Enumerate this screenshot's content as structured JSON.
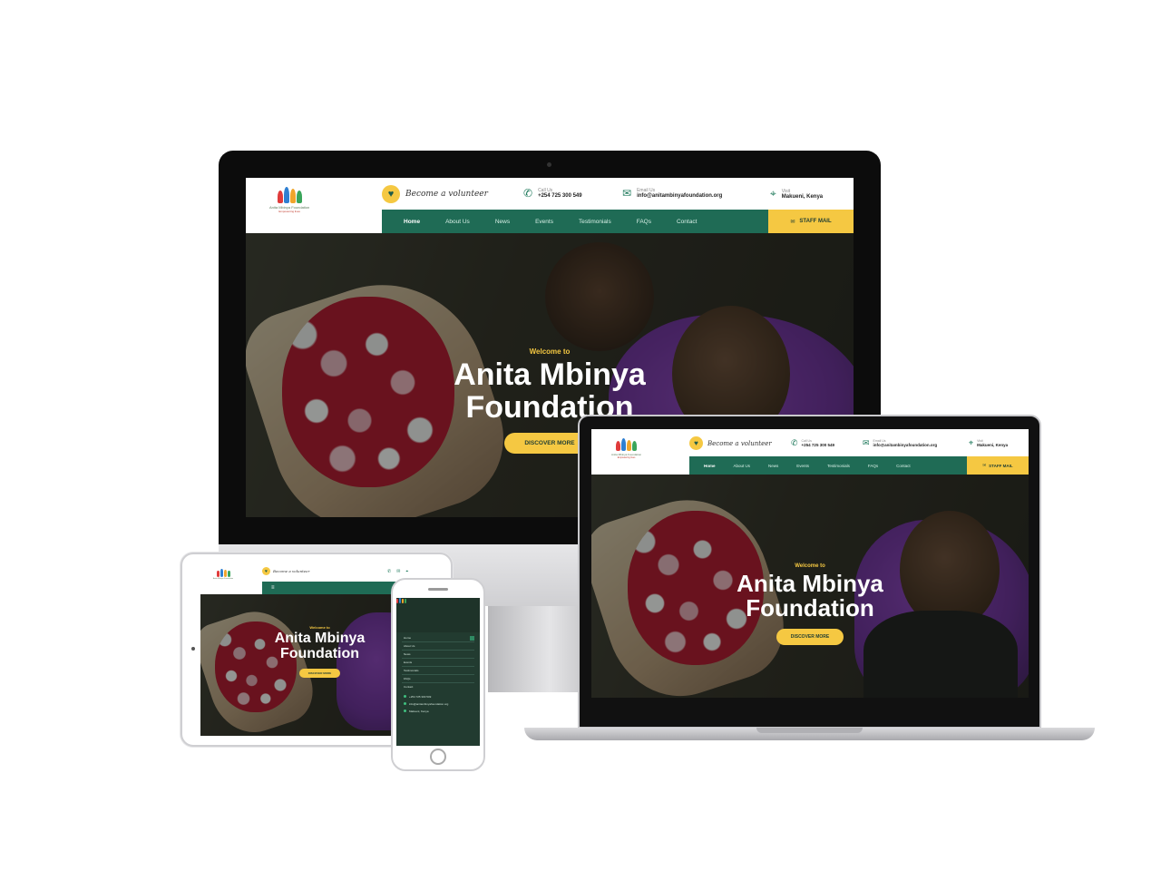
{
  "site": {
    "logo_text": "Anita Mbinya Foundation",
    "logo_sub": "Empowering lives",
    "volunteer": "Become a volunteer",
    "call_label": "Call Us",
    "call_value": "+254 725 300 549",
    "email_label": "Email Us",
    "email_value": "info@anitambinyafoundation.org",
    "location_label": "Visit",
    "location_value": "Makueni, Kenya",
    "nav": [
      "Home",
      "About Us",
      "News",
      "Events",
      "Testimonials",
      "FAQs",
      "Contact"
    ],
    "staff_button": "STAFF MAIL",
    "hero_welcome": "Welcome to",
    "hero_title_line1": "Anita Mbinya",
    "hero_title_line2": "Foundation",
    "hero_button": "DISCOVER MORE"
  },
  "phone_menu": {
    "items": [
      "Home",
      "About Us",
      "News",
      "Events",
      "Testimonials",
      "FAQs",
      "Contact"
    ]
  },
  "colors": {
    "brand_green": "#1f6b55",
    "brand_yellow": "#f5c842",
    "menu_dark": "#223b30"
  },
  "icons": [
    "heart-icon",
    "phone-icon",
    "email-icon",
    "location-icon",
    "mail-icon"
  ]
}
